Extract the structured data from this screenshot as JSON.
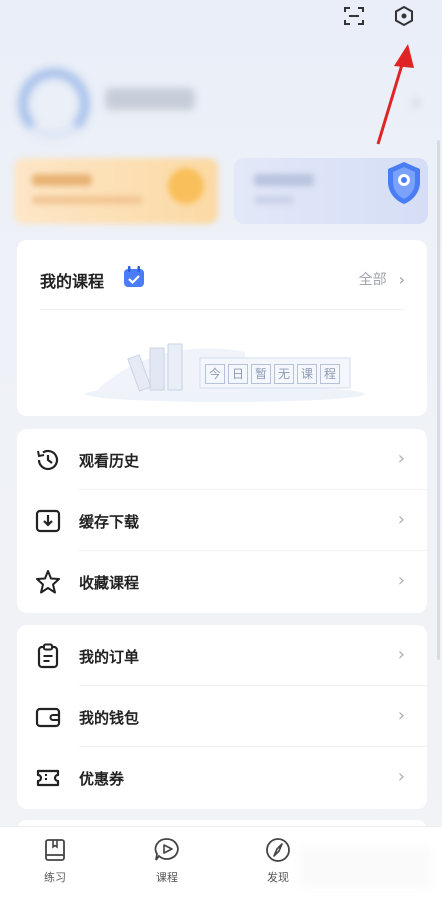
{
  "topbar": {
    "scan_icon": "scan-icon",
    "settings_icon": "settings-hexagon-icon"
  },
  "annotation": {
    "arrow_color": "#e02424"
  },
  "my_courses": {
    "title": "我的课程",
    "all_label": "全部",
    "empty_chars": [
      "今",
      "日",
      "暂",
      "无",
      "课",
      "程"
    ]
  },
  "menu_group_1": [
    {
      "label": "观看历史",
      "icon": "history-clock-icon"
    },
    {
      "label": "缓存下载",
      "icon": "download-icon"
    },
    {
      "label": "收藏课程",
      "icon": "star-icon"
    }
  ],
  "menu_group_2": [
    {
      "label": "我的订单",
      "icon": "clipboard-icon"
    },
    {
      "label": "我的钱包",
      "icon": "wallet-icon"
    },
    {
      "label": "优惠券",
      "icon": "coupon-icon"
    }
  ],
  "tabbar": {
    "practice": "练习",
    "course": "课程",
    "discover": "发现"
  },
  "colors": {
    "accent": "#4a7cf6",
    "text": "#222222",
    "muted": "#a0a5ae"
  }
}
